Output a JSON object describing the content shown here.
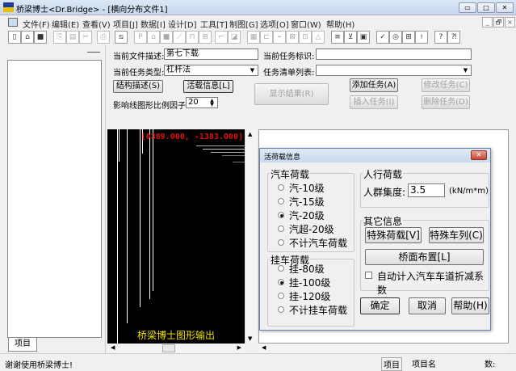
{
  "window": {
    "title": "桥梁博士<Dr.Bridge> - [横向分布文件1]",
    "min": "▭",
    "max": "□",
    "close": "✕"
  },
  "menu": [
    "文件(F)",
    "编辑(E)",
    "查看(V)",
    "项目[J]",
    "数据[I]",
    "设计[D]",
    "工具[T]",
    "制图[G]",
    "选项[O]",
    "窗口(W)",
    "帮助(H)"
  ],
  "mdi_controls": [
    "_",
    "🗗",
    "×"
  ],
  "toolbar": [
    {
      "icon": "new-icon",
      "g": "▯"
    },
    {
      "icon": "open-icon",
      "g": "⌂"
    },
    {
      "icon": "save-icon",
      "g": "■"
    },
    {
      "icon": "copy-icon",
      "g": "⎘",
      "dis": true
    },
    {
      "icon": "paste-icon",
      "g": "▤",
      "dis": true
    },
    {
      "icon": "cut-icon",
      "g": "✂",
      "dis": true
    },
    {
      "icon": "print-icon",
      "g": "⎙",
      "dis": true
    },
    {
      "icon": "view-icon",
      "g": "⧅"
    },
    {
      "icon": "page-icon",
      "g": "P",
      "dis": true
    },
    {
      "icon": "open2-icon",
      "g": "⌂",
      "dis": true
    },
    {
      "icon": "save2-icon",
      "g": "■",
      "dis": true
    },
    {
      "icon": "draw-icon",
      "g": "⟋",
      "dis": true
    },
    {
      "icon": "struct-icon",
      "g": "⊓",
      "dis": true
    },
    {
      "icon": "calc-icon",
      "g": "⊞",
      "dis": true
    },
    {
      "icon": "line-icon",
      "g": "⌐",
      "dis": true
    },
    {
      "icon": "shape-icon",
      "g": "◪",
      "dis": true
    },
    {
      "icon": "grid-icon",
      "g": "▦",
      "dis": true
    },
    {
      "icon": "tool1-icon",
      "g": "⊏",
      "dis": true
    },
    {
      "icon": "tool2-icon",
      "g": "⌁",
      "dis": true
    },
    {
      "icon": "tool3-icon",
      "g": "⊠",
      "dis": true
    },
    {
      "icon": "tool4-icon",
      "g": "⊡",
      "dis": true
    },
    {
      "icon": "tool5-icon",
      "g": "△",
      "dis": true
    },
    {
      "icon": "list-icon",
      "g": "≡"
    },
    {
      "icon": "check-icon",
      "g": "⊻"
    },
    {
      "icon": "frame-icon",
      "g": "▣"
    },
    {
      "icon": "pen-icon",
      "g": "✓"
    },
    {
      "icon": "target-icon",
      "g": "◎"
    },
    {
      "icon": "table-icon",
      "g": "⊞"
    },
    {
      "icon": "prop-icon",
      "g": "⟊"
    },
    {
      "icon": "help-icon",
      "g": "?"
    },
    {
      "icon": "context-help-icon",
      "g": "⁈"
    }
  ],
  "left": {
    "tab": "项目"
  },
  "form": {
    "file_desc_label": "当前文件描述:",
    "file_desc_value": "第七下载",
    "task_id_label": "当前任务标识:",
    "task_id_value": "",
    "task_type_label": "当前任务类型:",
    "task_type_value": "杠杆法",
    "task_list_label": "任务清单列表:",
    "task_list_value": "",
    "struct_btn": "结构描述(S)",
    "live_btn": "活载信息[L]",
    "show_btn": "显示结果(R)",
    "add_btn": "添加任务(A)",
    "modify_btn": "修改任务(C)",
    "insert_btn": "插入任务(I)",
    "delete_btn": "删除任务(D)",
    "scale_label": "影响线图形比例因子",
    "scale_value": "20"
  },
  "canvas": {
    "coord": "[0389.000, -1383.000]",
    "caption": "桥梁博士图形输出"
  },
  "dialog": {
    "title": "活荷载信息",
    "car": {
      "label": "汽车荷载",
      "options": [
        "汽-10级",
        "汽-15级",
        "汽-20级",
        "汽超-20级",
        "不计汽车荷载"
      ],
      "selected": 2
    },
    "trailer": {
      "label": "挂车荷载",
      "options": [
        "挂-80级",
        "挂-100级",
        "挂-120级",
        "不计挂车荷载"
      ],
      "selected": 1
    },
    "ped": {
      "label": "人行荷载",
      "density_label": "人群集度:",
      "density_value": "3.5",
      "unit": "(kN/m*m)"
    },
    "other": {
      "label": "其它信息",
      "special_load": "特殊荷载[V]",
      "special_train": "特殊车列(C)",
      "deck_layout": "桥面布置[L]",
      "auto_reduce": "自动计入汽车车道折减系数",
      "auto_reduce_checked": false
    },
    "ok": "确定",
    "cancel": "取消",
    "help": "帮助(H)"
  },
  "status": {
    "message": "谢谢使用桥梁博士!",
    "panel1": "项目",
    "panel2": "项目名",
    "panel3": "数:"
  }
}
